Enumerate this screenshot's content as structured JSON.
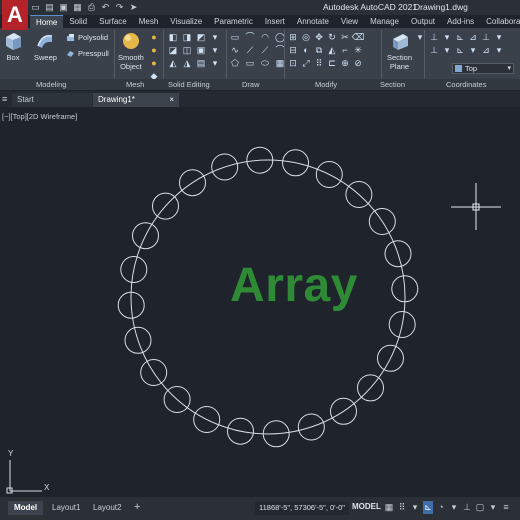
{
  "window": {
    "title": "Autodesk AutoCAD 2021",
    "file": "Drawing1.dwg",
    "app_letter": "A"
  },
  "quick_access": [
    "folder-icon",
    "open-icon",
    "save-icon",
    "save-as-icon",
    "plot-icon",
    "undo-icon",
    "redo-icon",
    "share-icon"
  ],
  "ribbon_tabs": [
    "Home",
    "Solid",
    "Surface",
    "Mesh",
    "Visualize",
    "Parametric",
    "Insert",
    "Annotate",
    "View",
    "Manage",
    "Output",
    "Add-ins",
    "Collaborate"
  ],
  "active_tab": "Home",
  "ribbon": {
    "box": "Box",
    "sweep": "Sweep",
    "polysolid": "Polysolid",
    "presspull": "Presspull",
    "smooth_object_1": "Smooth",
    "smooth_object_2": "Object",
    "section_plane_1": "Section",
    "section_plane_2": "Plane",
    "view_value": "Top",
    "panels": {
      "modeling": "Modeling",
      "mesh": "Mesh",
      "solid_editing": "Solid Editing",
      "draw": "Draw",
      "modify": "Modify",
      "section": "Section",
      "coordinates": "Coordinates"
    }
  },
  "file_tabs": {
    "menu": "≡",
    "start": "Start",
    "drawing": "Drawing1*",
    "close": "×"
  },
  "viewport": {
    "label": "[−][Top][2D Wireframe]",
    "overlay_text": "Array",
    "ucs_y": "Y",
    "ucs_x": "X"
  },
  "drawing": {
    "path_circle_radius": 137,
    "array_item_count": 24,
    "item_radius": 13,
    "line_color": "#d9dde3",
    "overlay_color": "#2f8a35"
  },
  "status": {
    "model_tab": "Model",
    "layout1": "Layout1",
    "layout2": "Layout2",
    "add": "+",
    "coordinates": "11868'-5\", 57306'-5\", 0'-0\"",
    "space": "MODEL"
  }
}
